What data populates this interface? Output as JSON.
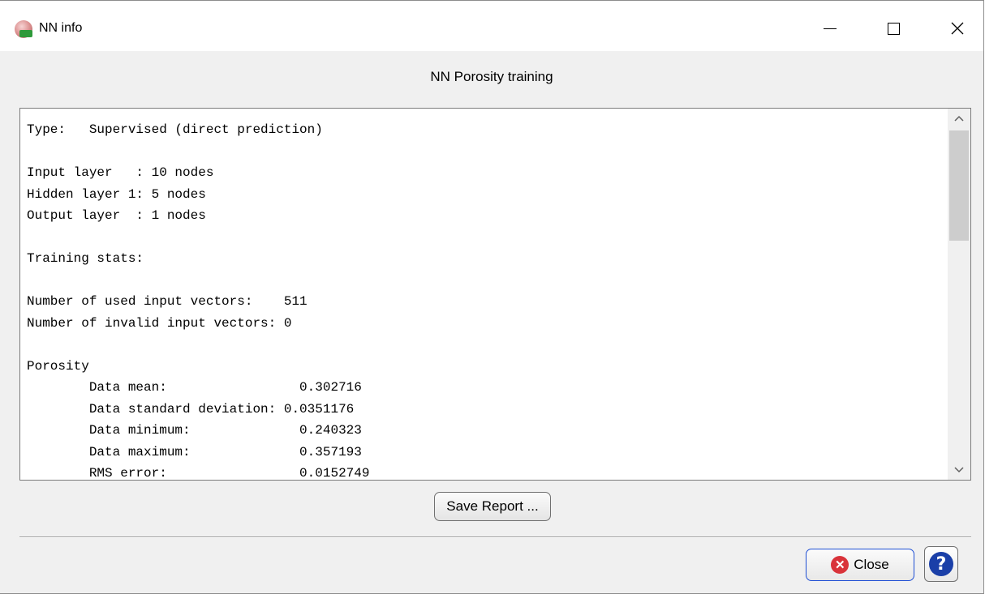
{
  "window": {
    "title": "NN info",
    "minimize_glyph": "—",
    "maximize_glyph": "☐",
    "close_glyph": "✕"
  },
  "caption": "NN Porosity training",
  "report_lines": [
    "Type:   Supervised (direct prediction)",
    "",
    "Input layer   : 10 nodes",
    "Hidden layer 1: 5 nodes",
    "Output layer  : 1 nodes",
    "",
    "Training stats:",
    "",
    "Number of used input vectors:    511",
    "Number of invalid input vectors: 0",
    "",
    "Porosity",
    "        Data mean:                 0.302716",
    "        Data standard deviation: 0.0351176",
    "        Data minimum:              0.240323",
    "        Data maximum:              0.357193",
    "        RMS error:                 0.0152749"
  ],
  "scrollbar": {
    "up_arrow": "^",
    "down_arrow": "v"
  },
  "buttons": {
    "save_report": "Save Report ...",
    "close": "Close",
    "help": "?"
  },
  "icons": {
    "app": "app-icon",
    "close": "close-circle-icon",
    "help": "help-icon"
  },
  "colors": {
    "close_icon": "#d9333a",
    "help_icon": "#1a3fa8",
    "close_border": "#1f4fd4"
  }
}
